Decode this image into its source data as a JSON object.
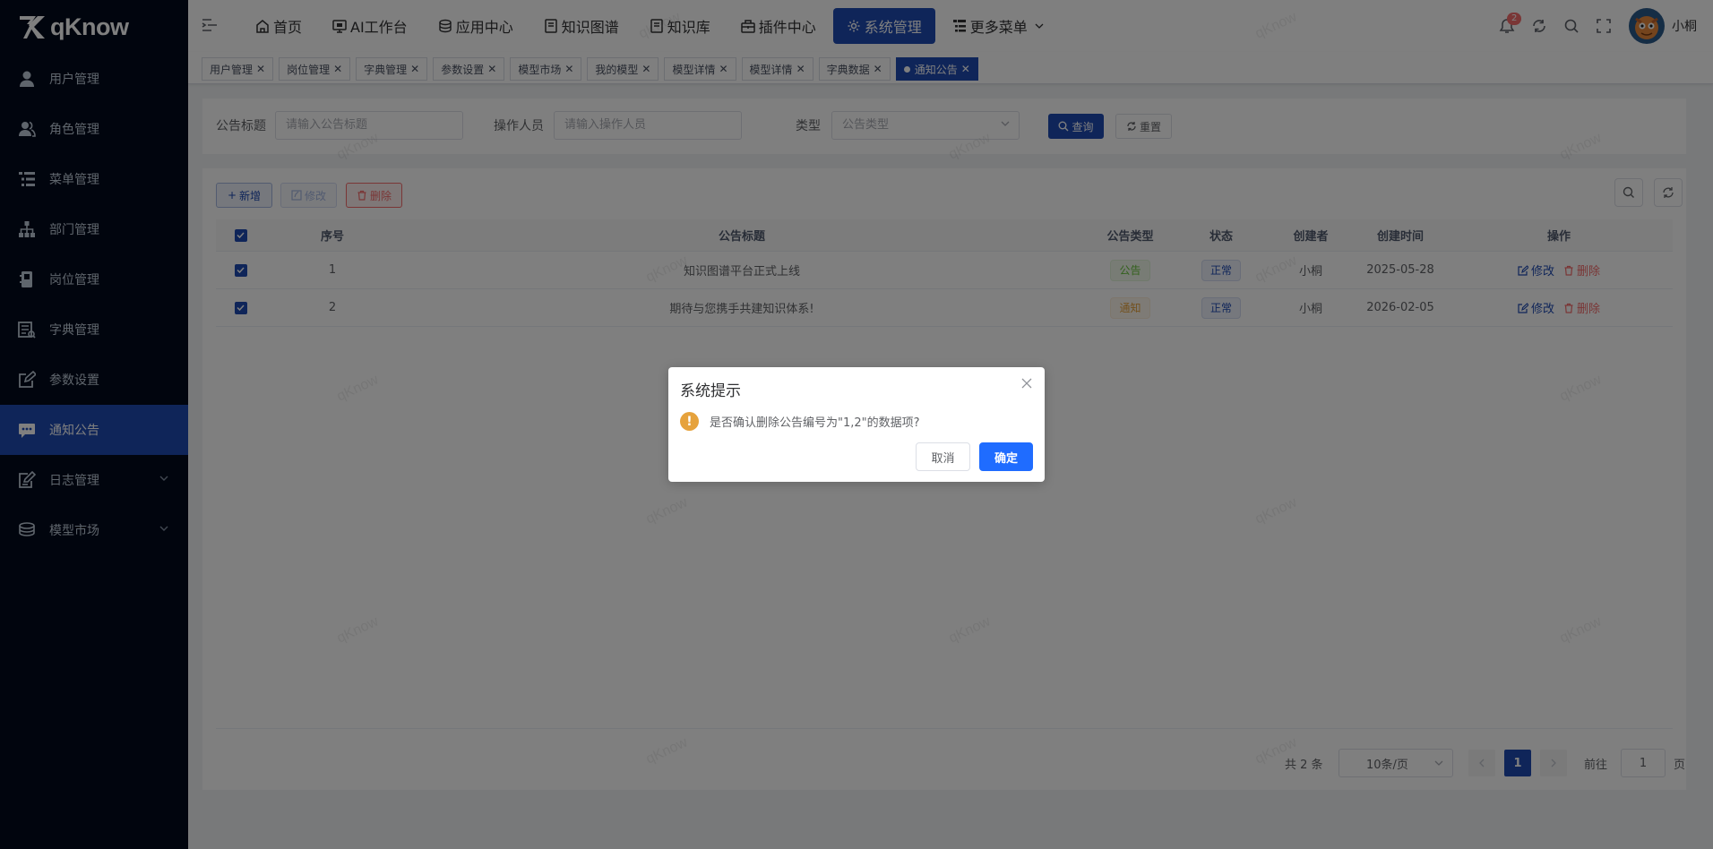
{
  "app": {
    "logo_text": "qKnow"
  },
  "sidebar": {
    "items": [
      {
        "label": "用户管理",
        "icon": "user-icon",
        "active": false
      },
      {
        "label": "角色管理",
        "icon": "peoples-icon",
        "active": false
      },
      {
        "label": "菜单管理",
        "icon": "tree-table-icon",
        "active": false
      },
      {
        "label": "部门管理",
        "icon": "tree-icon",
        "active": false
      },
      {
        "label": "岗位管理",
        "icon": "post-icon",
        "active": false
      },
      {
        "label": "字典管理",
        "icon": "dict-icon",
        "active": false
      },
      {
        "label": "参数设置",
        "icon": "edit-icon",
        "active": false
      },
      {
        "label": "通知公告",
        "icon": "message-icon",
        "active": true
      },
      {
        "label": "日志管理",
        "icon": "log-icon",
        "active": false
      },
      {
        "label": "模型市场",
        "icon": "model-icon",
        "active": false
      }
    ]
  },
  "topnav": {
    "items": [
      {
        "label": "首页",
        "icon": "home-icon"
      },
      {
        "label": "AI工作台",
        "icon": "monitor-icon"
      },
      {
        "label": "应用中心",
        "icon": "stack-icon"
      },
      {
        "label": "知识图谱",
        "icon": "book-icon"
      },
      {
        "label": "知识库",
        "icon": "book-icon"
      },
      {
        "label": "插件中心",
        "icon": "plugin-icon"
      },
      {
        "label": "系统管理",
        "icon": "gear-icon"
      },
      {
        "label": "更多菜单",
        "icon": "tree-table-icon"
      }
    ],
    "notification_count": "2",
    "username": "小桐"
  },
  "tags": [
    {
      "label": "用户管理"
    },
    {
      "label": "岗位管理"
    },
    {
      "label": "字典管理"
    },
    {
      "label": "参数设置"
    },
    {
      "label": "模型市场"
    },
    {
      "label": "我的模型"
    },
    {
      "label": "模型详情"
    },
    {
      "label": "模型详情"
    },
    {
      "label": "字典数据"
    },
    {
      "label": "通知公告"
    }
  ],
  "search": {
    "title_label": "公告标题",
    "title_placeholder": "请输入公告标题",
    "operator_label": "操作人员",
    "operator_placeholder": "请输入操作人员",
    "type_label": "类型",
    "type_placeholder": "公告类型",
    "query_label": "查询",
    "reset_label": "重置"
  },
  "toolbar": {
    "add_label": "新增",
    "edit_label": "修改",
    "delete_label": "删除"
  },
  "table": {
    "columns": [
      "序号",
      "公告标题",
      "公告类型",
      "状态",
      "创建者",
      "创建时间",
      "操作"
    ],
    "rows": [
      {
        "index": "1",
        "title": "知识图谱平台正式上线",
        "type": "公告",
        "status": "正常",
        "creator": "小桐",
        "created": "2025-05-28",
        "edit": "修改",
        "delete": "删除"
      },
      {
        "index": "2",
        "title": "期待与您携手共建知识体系!",
        "type": "通知",
        "status": "正常",
        "creator": "小桐",
        "created": "2026-02-05",
        "edit": "修改",
        "delete": "删除"
      }
    ]
  },
  "pagination": {
    "total": "共 2 条",
    "page_size": "10条/页",
    "current_page": "1",
    "goto_label": "前往",
    "goto_value": "1",
    "page_suffix": "页"
  },
  "dialog": {
    "title": "系统提示",
    "message": "是否确认删除公告编号为\"1,2\"的数据项?",
    "cancel_label": "取消",
    "confirm_label": "确定"
  },
  "watermark": "qKnow",
  "colors": {
    "primary": "#1f4ab3",
    "sidebar_bg": "#020b1c",
    "danger": "#f56c6c",
    "warning": "#e6a23c",
    "success": "#67c23a",
    "dialog_confirm": "#1f6cff"
  }
}
